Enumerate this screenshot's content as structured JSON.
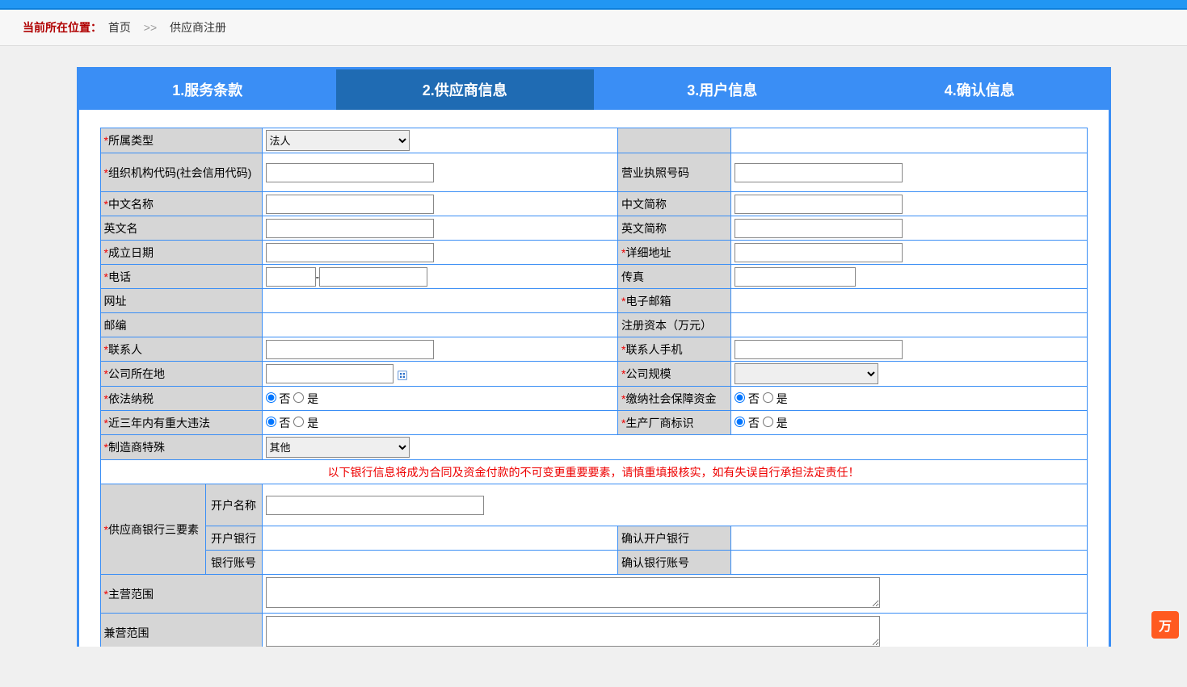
{
  "breadcrumb": {
    "label": "当前所在位置：",
    "home": "首页",
    "sep": ">>",
    "current": "供应商注册"
  },
  "tabs": {
    "t1": "1.服务条款",
    "t2": "2.供应商信息",
    "t3": "3.用户信息",
    "t4": "4.确认信息"
  },
  "labels": {
    "type": "所属类型",
    "orgcode": "组织机构代码(社会信用代码)",
    "licenseno": "营业执照号码",
    "cnname": "中文名称",
    "cnshort": "中文简称",
    "enname": "英文名",
    "enshort": "英文简称",
    "founddate": "成立日期",
    "address": "详细地址",
    "phone": "电话",
    "fax": "传真",
    "website": "网址",
    "email": "电子邮箱",
    "postcode": "邮编",
    "regcap": "注册资本（万元）",
    "contact": "联系人",
    "contactphone": "联系人手机",
    "location": "公司所在地",
    "scale": "公司规模",
    "taxlaw": "依法纳税",
    "social": "缴纳社会保障资金",
    "violation": "近三年内有重大违法",
    "manuf": "生产厂商标识",
    "manufspecial": "制造商特殊",
    "bank3": "供应商银行三要素",
    "bankaccname": "开户名称",
    "bankname_open": "开户银行",
    "bankname_confirm": "确认开户银行",
    "bankacc": "银行账号",
    "bankacc_confirm": "确认银行账号",
    "mainbiz": "主营范围",
    "sidebiz": "兼营范围"
  },
  "options": {
    "type_selected": "法人",
    "manufspecial_selected": "其他",
    "no": "否",
    "yes": "是"
  },
  "warning": "以下银行信息将成为合同及资金付款的不可变更重要要素，请慎重填报核实，如有失误自行承担法定责任！",
  "float_btn": "万"
}
